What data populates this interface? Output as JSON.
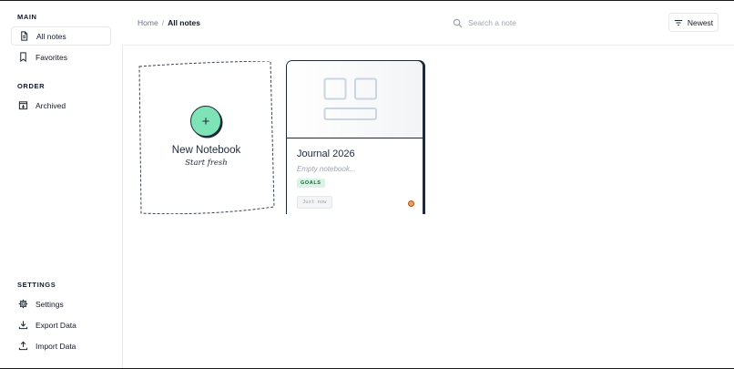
{
  "sidebar": {
    "sections": [
      {
        "label": "MAIN"
      },
      {
        "label": "ORDER"
      },
      {
        "label": "SETTINGS"
      }
    ],
    "main_items": [
      {
        "label": "All notes",
        "icon": "document-icon",
        "active": true
      },
      {
        "label": "Favorites",
        "icon": "bookmark-icon",
        "active": false
      }
    ],
    "order_items": [
      {
        "label": "Archived",
        "icon": "archive-icon"
      }
    ],
    "settings_items": [
      {
        "label": "Settings",
        "icon": "gear-icon"
      },
      {
        "label": "Export Data",
        "icon": "download-icon"
      },
      {
        "label": "Import Data",
        "icon": "upload-icon"
      }
    ]
  },
  "header": {
    "breadcrumb": {
      "home": "Home",
      "separator": "/",
      "current": "All notes"
    },
    "search": {
      "placeholder": "Search a note",
      "value": ""
    },
    "sort": {
      "label": "Newest"
    }
  },
  "new_notebook": {
    "plus": "+",
    "title": "New Notebook",
    "subtitle": "Start fresh"
  },
  "notes": [
    {
      "title": "Journal 2026",
      "subtitle": "Empty notebook...",
      "tag": "GOALS",
      "timestamp": "Just now"
    }
  ],
  "colors": {
    "accent_green": "#7fe3b8",
    "tag_bg": "#d9f3e6",
    "tag_text": "#166534",
    "status_dot": "#e8a06b"
  }
}
